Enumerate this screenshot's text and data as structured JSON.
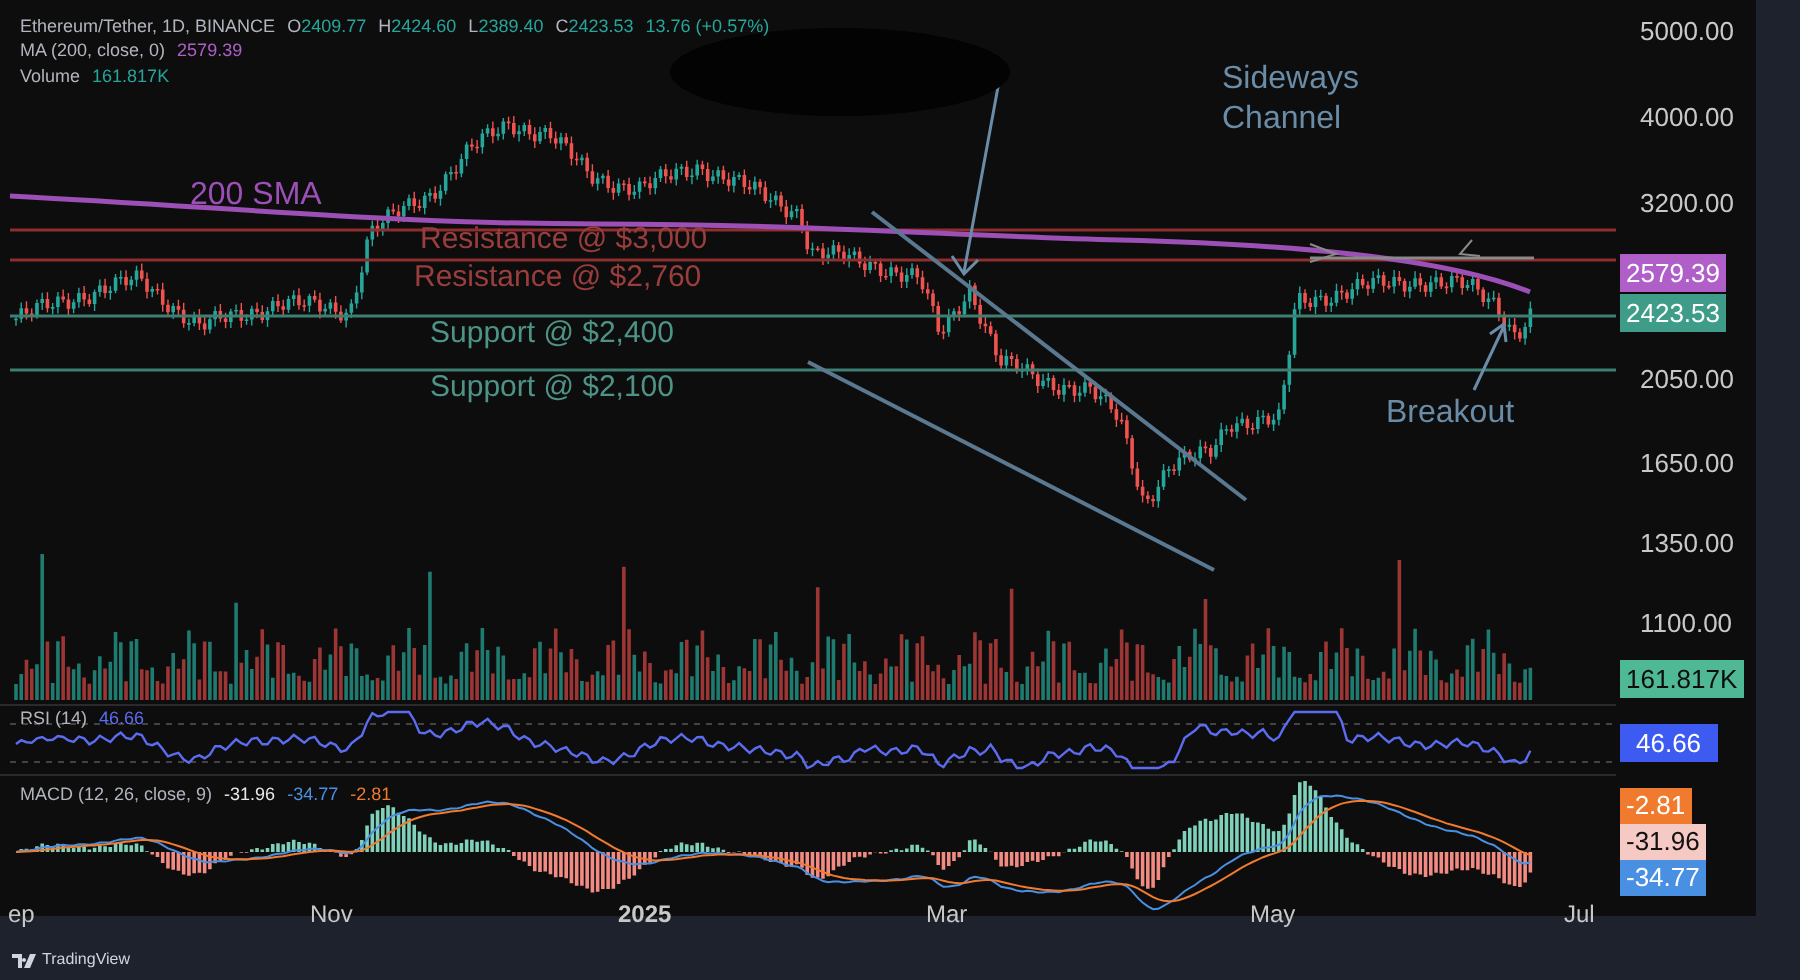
{
  "legend": {
    "symbol": "Ethereum/Tether, 1D, BINANCE",
    "ohlc": [
      {
        "label": "O",
        "value": "2409.77"
      },
      {
        "label": "H",
        "value": "2424.60"
      },
      {
        "label": "L",
        "value": "2389.40"
      },
      {
        "label": "C",
        "value": "2423.53"
      }
    ],
    "change": "13.76 (+0.57%)",
    "ma": {
      "label": "MA (200, close, 0)",
      "value": "2579.39"
    },
    "volume": {
      "label": "Volume",
      "value": "161.817K"
    }
  },
  "annotations": [
    {
      "kind": "label",
      "text": "200 SMA",
      "color": "#9c4fb5"
    },
    {
      "kind": "label",
      "text": "Resistance @ $3,000",
      "color": "#9a3d3d"
    },
    {
      "kind": "label",
      "text": "Resistance @ $2,760",
      "color": "#9a3d3d"
    },
    {
      "kind": "label",
      "text": "Support @ $2,400",
      "color": "#4e9486"
    },
    {
      "kind": "label",
      "text": "Support @ $2,100",
      "color": "#4e9486"
    },
    {
      "kind": "label",
      "text": "Sideways Channel",
      "color": "#6a8ca6"
    },
    {
      "kind": "label",
      "text": "Breakout",
      "color": "#6a8ca6"
    }
  ],
  "price_axis": {
    "ticks": [
      "5000.00",
      "4000.00",
      "3200.00",
      "2050.00",
      "1650.00",
      "1350.00",
      "1100.00"
    ],
    "badges": [
      {
        "text": "2579.39",
        "color": "#b05fc9"
      },
      {
        "text": "2423.53",
        "color": "#3e9c88"
      },
      {
        "text": "161.817K",
        "color": "#4fb895"
      }
    ]
  },
  "rsi": {
    "label": "RSI (14)",
    "value": "46.66",
    "badge": {
      "text": "46.66",
      "color": "#3d5bf0"
    }
  },
  "macd": {
    "label": "MACD (12, 26, close, 9)",
    "values": [
      {
        "text": "-31.96",
        "color": "#e8e8e8"
      },
      {
        "text": "-34.77",
        "color": "#4a90e2"
      },
      {
        "text": "-2.81",
        "color": "#f07a2e"
      }
    ],
    "badges": [
      {
        "text": "-2.81",
        "color": "#f07a2e"
      },
      {
        "text": "-31.96",
        "color": "#f5c9c4"
      },
      {
        "text": "-34.77",
        "color": "#4a90e2"
      }
    ]
  },
  "time_axis": [
    {
      "text": "ep",
      "bold": false
    },
    {
      "text": "Nov",
      "bold": false
    },
    {
      "text": "2025",
      "bold": true
    },
    {
      "text": "Mar",
      "bold": false
    },
    {
      "text": "May",
      "bold": false
    },
    {
      "text": "Jul",
      "bold": false
    }
  ],
  "footer": {
    "brand": "TradingView"
  }
}
